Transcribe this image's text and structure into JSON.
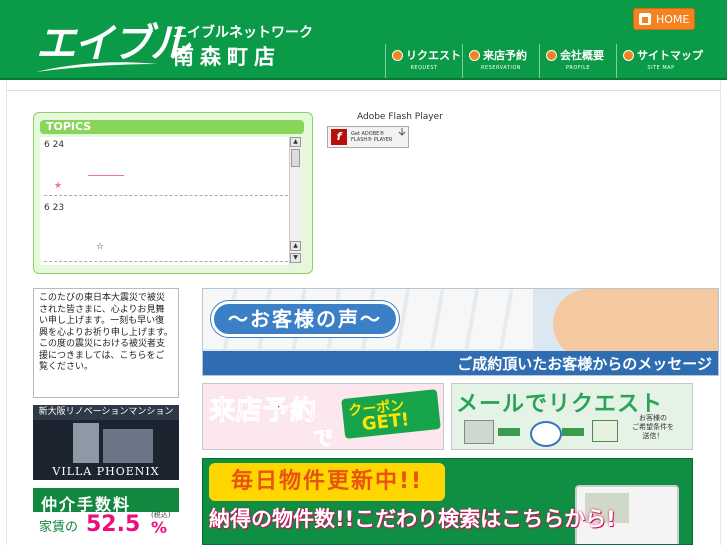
{
  "header": {
    "logo_text": "エイブル",
    "brand_subtitle": "エイブルネットワーク",
    "store_name": "南森町店",
    "home_label": "HOME",
    "nav": [
      {
        "label": "リクエスト",
        "sub": "REQUEST"
      },
      {
        "label": "来店予約",
        "sub": "RESERVATION"
      },
      {
        "label": "会社概要",
        "sub": "PROFILE"
      },
      {
        "label": "サイトマップ",
        "sub": "SITE MAP"
      }
    ]
  },
  "topics": {
    "title": "TOPICS",
    "items": [
      {
        "date": "6 24",
        "mark": "★"
      },
      {
        "date": "6 23",
        "mark": "☆"
      }
    ],
    "scroll_up": "▲",
    "scroll_down": "▼"
  },
  "flash": {
    "title": "Adobe Flash Player",
    "badge_line1": "Get ADOBE®",
    "badge_line2": "FLASH® PLAYER"
  },
  "notice": {
    "text": "このたびの東日本大震災で被災された皆さまに、心よりお見舞い申し上げます。一刻も早い復興を心よりお祈り申し上げます。この度の震災における被災者支援につきましては、こちらをご覧ください。"
  },
  "villa": {
    "caption": "新大阪リノベーションマンション",
    "name": "VILLA PHOENIX"
  },
  "fee": {
    "title": "仲介手数料",
    "prefix": "家賃の",
    "value": "52.5",
    "unit": "%",
    "tax": "(税込)"
  },
  "banners": {
    "voice_title": "〜お客様の声〜",
    "voice_bar": "ご成約頂いたお客様からのメッセージ",
    "coupon_main": "来店予約",
    "coupon_de": "で",
    "coupon_word": "クーポン",
    "coupon_get": "GET!",
    "request_title": "メールでリクエスト",
    "request_note": "お客様の\nご希望条件を\n送信！",
    "update_pill": "毎日物件更新中!!",
    "update_line": "納得の物件数!!こだわり検索はこちらから!"
  }
}
